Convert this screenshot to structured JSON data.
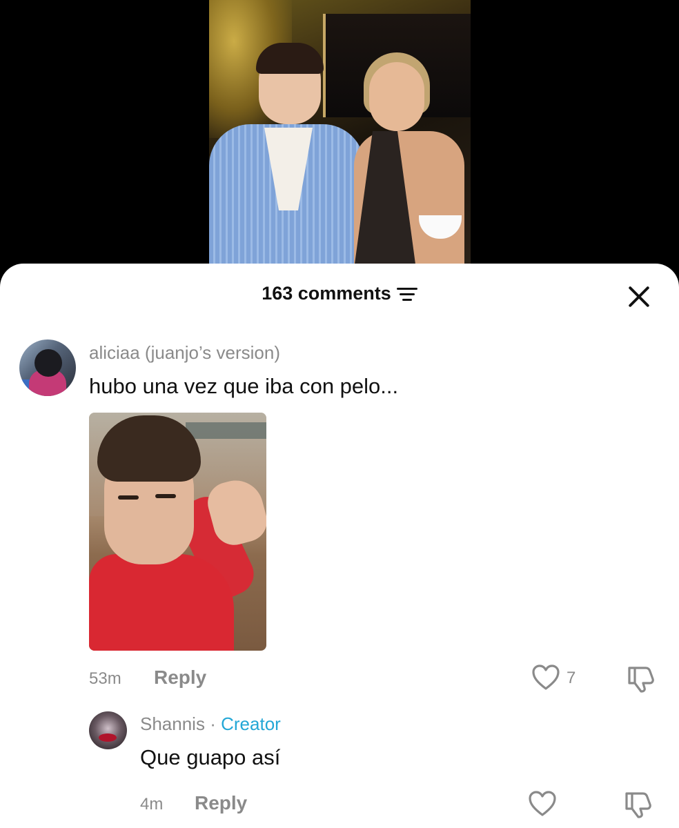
{
  "comments_header": {
    "count_label": "163 comments"
  },
  "comments": [
    {
      "username": "aliciaa (juanjo’s version)",
      "text": "hubo una vez que iba con pelo...",
      "time": "53m",
      "reply_label": "Reply",
      "likes": "7",
      "has_image": true
    },
    {
      "username": "Shannis",
      "separator": "·",
      "badge": "Creator",
      "text": "Que guapo así",
      "time": "4m",
      "reply_label": "Reply"
    }
  ],
  "colors": {
    "creator_badge": "#23a7d6",
    "muted_text": "#8a8a8a",
    "sheet_background": "#ffffff",
    "video_background": "#000000"
  },
  "icons": {
    "filter": "sort-lines-icon",
    "close": "close-x-icon",
    "like": "heart-outline-icon",
    "dislike": "thumbs-down-outline-icon"
  }
}
